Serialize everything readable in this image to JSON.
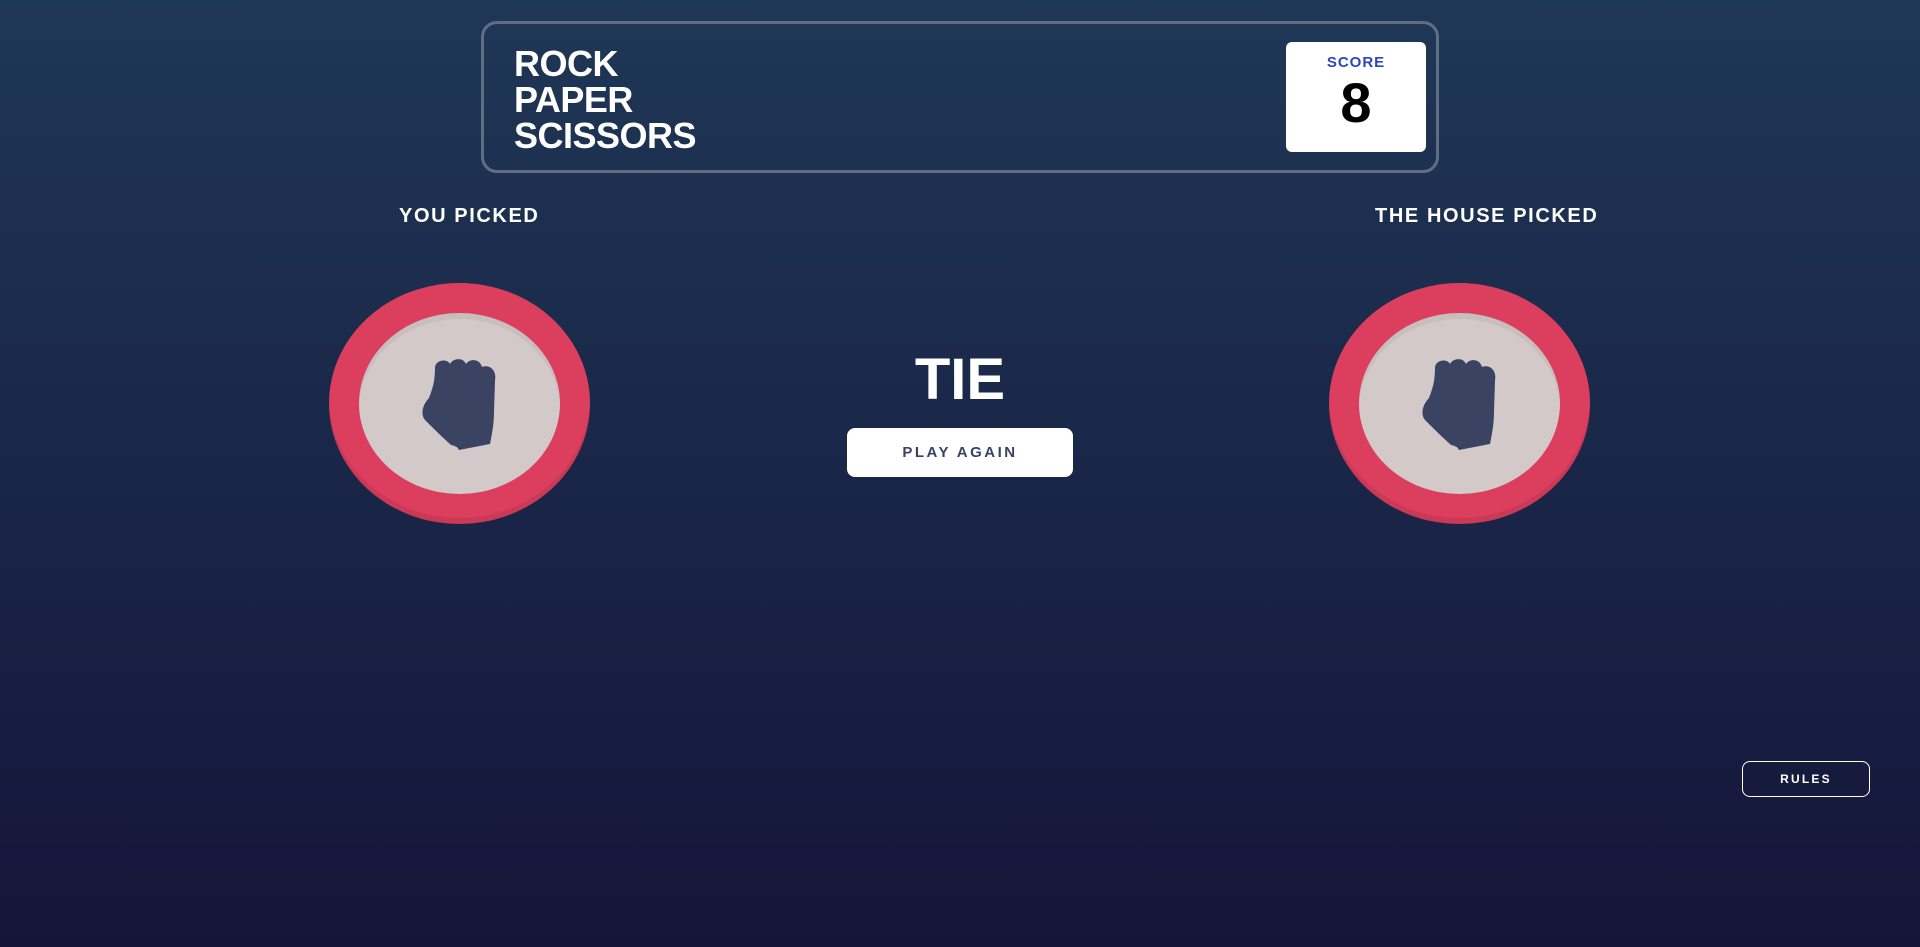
{
  "header": {
    "title_lines": [
      "ROCK",
      "PAPER",
      "SCISSORS"
    ],
    "score_label": "SCORE",
    "score_value": "8"
  },
  "player": {
    "label": "YOU PICKED",
    "choice_icon": "rock-icon"
  },
  "house": {
    "label": "THE HOUSE PICKED",
    "choice_icon": "rock-icon"
  },
  "result": {
    "text": "TIE",
    "play_again_label": "PLAY AGAIN"
  },
  "rules_label": "RULES",
  "colors": {
    "rock_ring": "#dc3f5e",
    "token_face": "#d3c9c9",
    "icon": "#3b4363",
    "score_label": "#2a46c0",
    "header_border": "#606e85"
  }
}
